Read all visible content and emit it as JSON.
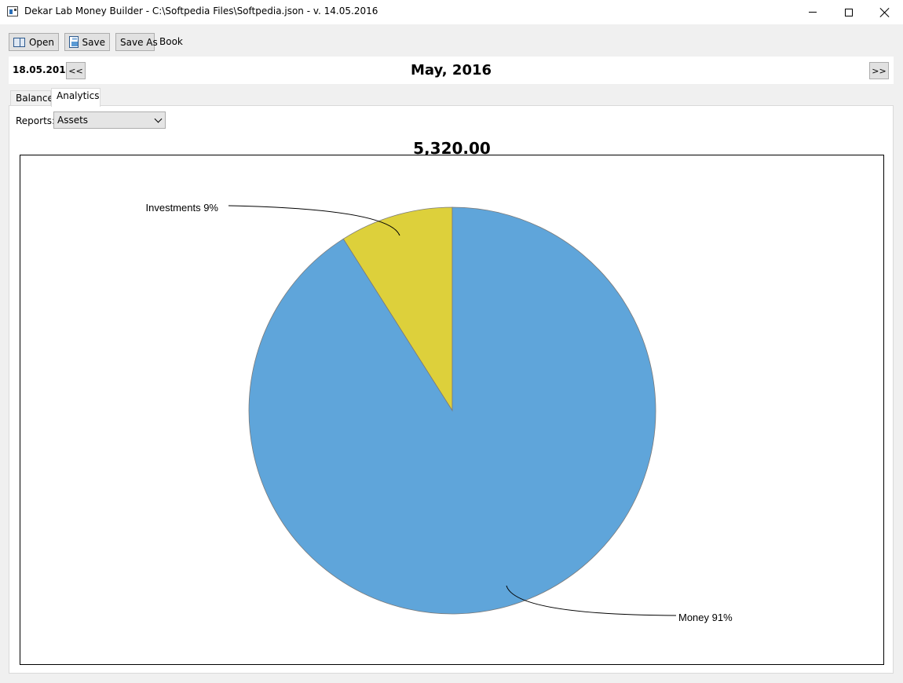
{
  "window": {
    "title": "Dekar Lab Money Builder - C:\\Softpedia Files\\Softpedia.json - v. 14.05.2016"
  },
  "toolbar": {
    "open_label": "Open",
    "save_label": "Save",
    "save_as_label": "Save As",
    "book_label": "Book"
  },
  "datebar": {
    "date": "18.05.2016",
    "prev_label": "<<",
    "next_label": ">>",
    "month": "May, 2016"
  },
  "tabs": [
    {
      "label": "Balance",
      "active": false
    },
    {
      "label": "Analytics",
      "active": true
    }
  ],
  "reports": {
    "label": "Reports:",
    "selected": "Assets"
  },
  "total": "5,320.00",
  "colors": {
    "money": "#5fa5da",
    "investments": "#ddd03b",
    "slice_border": "#7a7a7a"
  },
  "chart_data": {
    "type": "pie",
    "title": "",
    "slices": [
      {
        "name": "Investments",
        "label": "Investments 9%",
        "value": 9
      },
      {
        "name": "Money",
        "label": "Money 91%",
        "value": 91
      }
    ]
  }
}
